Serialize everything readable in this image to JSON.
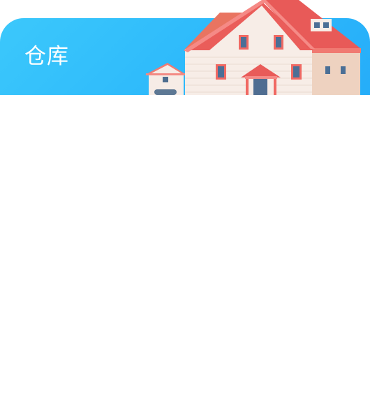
{
  "header": {
    "title": "仓库",
    "illustration_icon": "house-illustration",
    "gradient_colors": [
      "#3cc8fb",
      "#26adf9"
    ]
  }
}
